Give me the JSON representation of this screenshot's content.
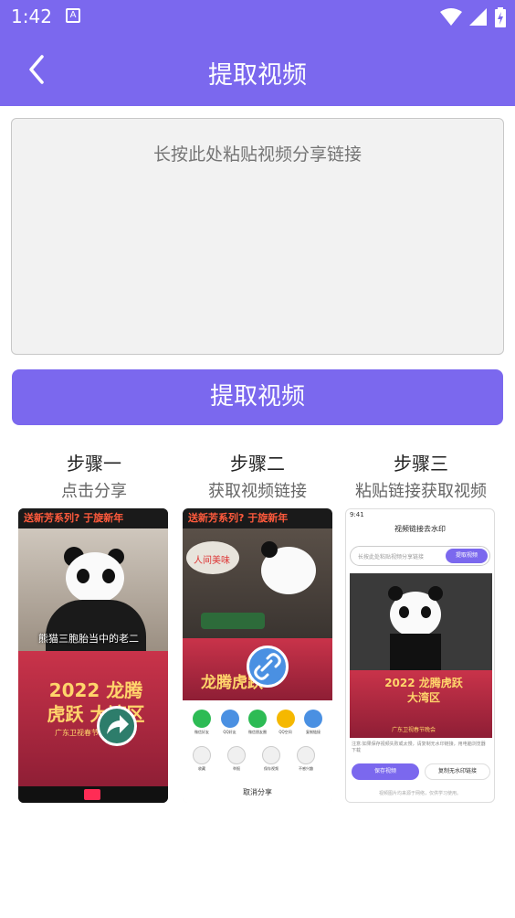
{
  "status": {
    "time": "1:42",
    "notification": "A"
  },
  "header": {
    "title": "提取视频"
  },
  "input": {
    "placeholder": "长按此处粘贴视频分享链接"
  },
  "extract_button": "提取视频",
  "steps": [
    {
      "title": "步骤一",
      "subtitle": "点击分享"
    },
    {
      "title": "步骤二",
      "subtitle": "获取视频链接"
    },
    {
      "title": "步骤三",
      "subtitle": "粘贴链接获取视频"
    }
  ],
  "shot1": {
    "banner": "送新芳系列? 于旋新年",
    "caption": "熊猫三胞胎当中的老二",
    "gold_text": "2022 龙腾虎跃 大湾区",
    "brand": "广东卫视春节晚会"
  },
  "shot2": {
    "banner": "送新芳系列? 于旋新年",
    "bubble": "人间美味",
    "gold_text": "龙腾虎跃",
    "share_apps_row1": [
      "微信好友",
      "QQ好友",
      "微信朋友圈",
      "QQ空间",
      "复制链接"
    ],
    "share_apps_row2": [
      "收藏",
      "举报",
      "保存视频",
      "不感兴趣"
    ],
    "cancel": "取消分享"
  },
  "shot3": {
    "time": "9:41",
    "title": "视频链接去水印",
    "input_placeholder": "长按此处粘贴视频分享链接",
    "button": "提取视频",
    "gold_text": "2022 龙腾虎跃 大湾区",
    "brand": "广东卫视春节晚会",
    "note": "注意:如果保存视频失败或太慢，请复制无水印链接，用电脑浏览器下载",
    "save": "保存视频",
    "copy": "复制无水印链接",
    "footer": "视频图片均来源于网络，仅供学习使用。"
  },
  "colors": {
    "accent": "#7b68ee"
  }
}
